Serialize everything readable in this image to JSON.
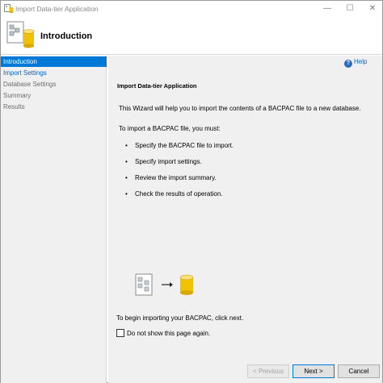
{
  "window": {
    "title": "Import Data-tier Application",
    "controls": {
      "minimize": "—",
      "maximize": "☐",
      "close": "✕"
    }
  },
  "header": {
    "title": "Introduction"
  },
  "sidebar": {
    "items": [
      {
        "label": "Introduction",
        "state": "active"
      },
      {
        "label": "Import Settings",
        "state": "link"
      },
      {
        "label": "Database Settings",
        "state": "disabled"
      },
      {
        "label": "Summary",
        "state": "disabled"
      },
      {
        "label": "Results",
        "state": "disabled"
      }
    ]
  },
  "content": {
    "help_label": "Help",
    "section_title": "Import Data-tier Application",
    "intro": "This Wizard will help you to import the contents of a BACPAC file to a new database.",
    "requirements_intro": "To import a BACPAC file, you must:",
    "bullets": [
      "Specify the BACPAC file to import.",
      "Specify import settings.",
      "Review the import summary.",
      "Check the results of operation."
    ],
    "begin_text": "To begin importing your BACPAC, click next.",
    "dont_show_label": "Do not show this page again.",
    "dont_show_checked": false
  },
  "footer": {
    "previous_label": "< Previous",
    "next_label": "Next >",
    "cancel_label": "Cancel"
  },
  "colors": {
    "accent": "#0078d7",
    "link": "#0064c8",
    "panel_bg": "#f0f0f0",
    "database_gold": "#f2c100"
  }
}
